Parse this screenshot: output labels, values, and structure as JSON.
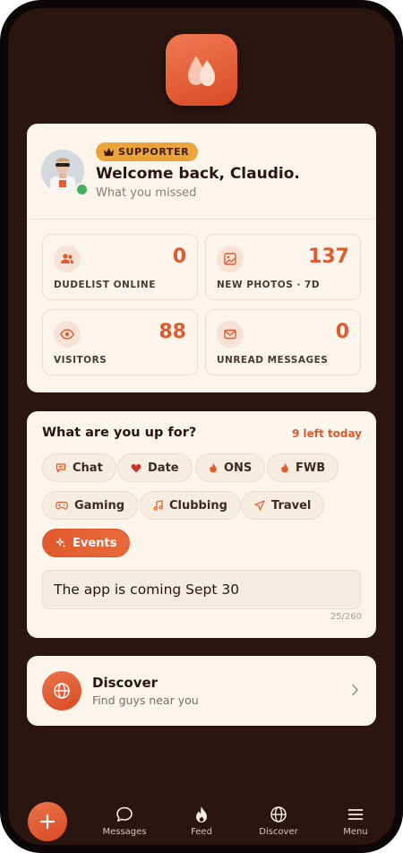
{
  "welcome": {
    "badge": "SUPPORTER",
    "title": "Welcome back, Claudio.",
    "subtitle": "What you missed"
  },
  "stats": [
    {
      "icon": "users-icon",
      "value": "0",
      "label": "DUDELIST ONLINE"
    },
    {
      "icon": "image-icon",
      "value": "137",
      "label": "NEW PHOTOS · 7D"
    },
    {
      "icon": "eye-icon",
      "value": "88",
      "label": "VISITORS"
    },
    {
      "icon": "mail-icon",
      "value": "0",
      "label": "UNREAD MESSAGES"
    }
  ],
  "up_for": {
    "title": "What are you up for?",
    "remaining": "9 left today",
    "chips": [
      {
        "icon": "chat-icon",
        "label": "Chat",
        "selected": false
      },
      {
        "icon": "heart-icon",
        "label": "Date",
        "selected": false
      },
      {
        "icon": "flame-icon",
        "label": "ONS",
        "selected": false
      },
      {
        "icon": "flame-icon",
        "label": "FWB",
        "selected": false
      },
      {
        "icon": "gamepad-icon",
        "label": "Gaming",
        "selected": false
      },
      {
        "icon": "music-icon",
        "label": "Clubbing",
        "selected": false
      },
      {
        "icon": "plane-icon",
        "label": "Travel",
        "selected": false
      },
      {
        "icon": "sparkle-icon",
        "label": "Events",
        "selected": true
      }
    ],
    "status_text": "The app is coming Sept 30",
    "char_count": "25/260"
  },
  "discover": {
    "title": "Discover",
    "subtitle": "Find guys near you"
  },
  "nav": {
    "messages": "Messages",
    "feed": "Feed",
    "discover": "Discover",
    "menu": "Menu"
  },
  "colors": {
    "accent": "#df5a2d",
    "badge": "#eca33a",
    "background": "#2b1510",
    "card": "#fcf5ec",
    "online": "#3fb061"
  }
}
